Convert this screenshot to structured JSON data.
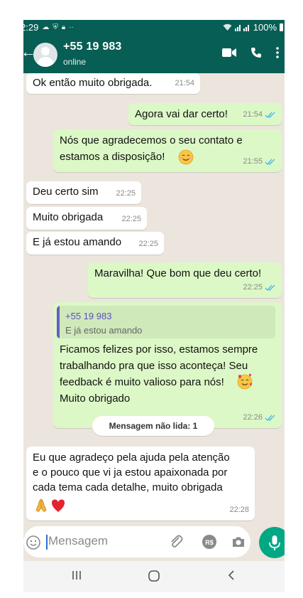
{
  "status_bar": {
    "time": "2:29",
    "battery": "100%"
  },
  "header": {
    "contact_name": "+55 19 983",
    "contact_status": "online"
  },
  "messages": [
    {
      "dir": "in",
      "text": "Ok então muito obrigada.",
      "time": "21:54"
    },
    {
      "dir": "out",
      "text": "Agora vai dar certo!",
      "time": "21:54"
    },
    {
      "dir": "out",
      "text_line1": "Nós que agradecemos o seu contato e",
      "text_line2": "estamos a disposição!",
      "emoji": "smiling-face-emoji",
      "time": "21:55"
    },
    {
      "dir": "in",
      "text": "Deu certo sim",
      "time": "22:25"
    },
    {
      "dir": "in",
      "text": "Muito obrigada",
      "time": "22:25"
    },
    {
      "dir": "in",
      "text": "E já estou amando",
      "time": "22:25"
    },
    {
      "dir": "out",
      "text": "Maravilha! Que bom que deu certo!",
      "time": "22:25"
    },
    {
      "dir": "out",
      "quote_name": "+55 19 983",
      "quote_text": "E já estou amando",
      "line1": "Ficamos felizes por isso, estamos sempre",
      "line2": "trabalhando pra que isso aconteça! Seu",
      "line3": "feedback é muito valioso para nós!",
      "line4": "Muito obrigado",
      "emoji": "smiling-face-with-hearts-emoji",
      "time": "22:26"
    },
    {
      "dir": "in",
      "line1": "Eu que agradeço pela ajuda pela atenção",
      "line2": "e o pouco que vi ja estou apaixonada por",
      "line3": "cada tema cada detalhe, muito obrigada",
      "emojis": [
        "folded-hands-emoji",
        "red-heart-emoji"
      ],
      "time": "22:28"
    }
  ],
  "unread_banner": "Mensagem não lida: 1",
  "composer": {
    "placeholder": "Mensagem"
  },
  "colors": {
    "header": "#075e54",
    "chat_bg": "#ece5dd",
    "outgoing": "#dcf8c6",
    "incoming": "#ffffff",
    "read_tick": "#4fb6ec",
    "mic": "#00a884"
  }
}
